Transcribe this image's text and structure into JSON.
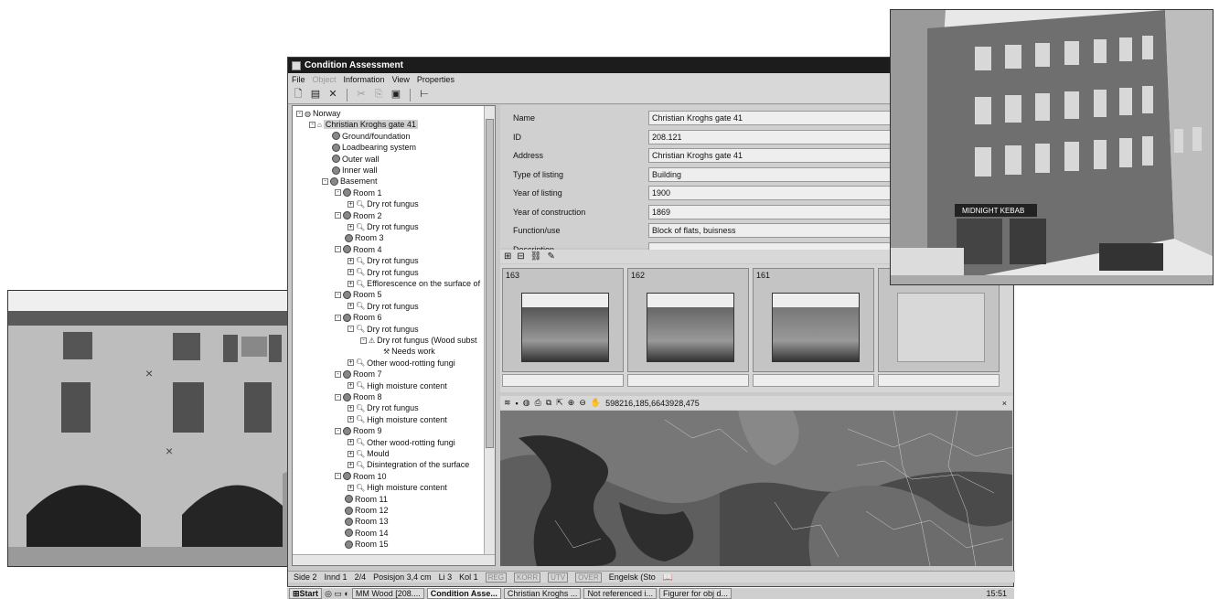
{
  "window": {
    "title": "Condition Assessment"
  },
  "menu": [
    "File",
    "Object",
    "Information",
    "View",
    "Properties"
  ],
  "menu_disabled": [
    "Object"
  ],
  "tree": [
    {
      "level": 0,
      "toggle": "−",
      "icon": "globe-icon",
      "label": "Norway"
    },
    {
      "level": 1,
      "toggle": "−",
      "icon": "building-icon",
      "label": "Christian Kroghs gate 41",
      "selected": true
    },
    {
      "level": 2,
      "toggle": "",
      "icon": "component-icon",
      "label": "Ground/foundation"
    },
    {
      "level": 2,
      "toggle": "",
      "icon": "component-icon",
      "label": "Loadbearing system"
    },
    {
      "level": 2,
      "toggle": "",
      "icon": "component-icon",
      "label": "Outer wall"
    },
    {
      "level": 2,
      "toggle": "",
      "icon": "component-icon",
      "label": "Inner wall"
    },
    {
      "level": 2,
      "toggle": "−",
      "icon": "component-icon",
      "label": "Basement"
    },
    {
      "level": 3,
      "toggle": "−",
      "icon": "component-icon",
      "label": "Room 1"
    },
    {
      "level": 4,
      "toggle": "+",
      "icon": "magnifier-icon",
      "label": "Dry rot fungus"
    },
    {
      "level": 3,
      "toggle": "−",
      "icon": "component-icon",
      "label": "Room 2"
    },
    {
      "level": 4,
      "toggle": "+",
      "icon": "magnifier-icon",
      "label": "Dry rot fungus"
    },
    {
      "level": 3,
      "toggle": "",
      "icon": "component-icon",
      "label": "Room 3"
    },
    {
      "level": 3,
      "toggle": "−",
      "icon": "component-icon",
      "label": "Room 4"
    },
    {
      "level": 4,
      "toggle": "+",
      "icon": "magnifier-icon",
      "label": "Dry rot fungus"
    },
    {
      "level": 4,
      "toggle": "+",
      "icon": "magnifier-icon",
      "label": "Dry rot fungus"
    },
    {
      "level": 4,
      "toggle": "+",
      "icon": "magnifier-icon",
      "label": "Efflorescence on the surface of"
    },
    {
      "level": 3,
      "toggle": "−",
      "icon": "component-icon",
      "label": "Room 5"
    },
    {
      "level": 4,
      "toggle": "+",
      "icon": "magnifier-icon",
      "label": "Dry rot fungus"
    },
    {
      "level": 3,
      "toggle": "−",
      "icon": "component-icon",
      "label": "Room 6"
    },
    {
      "level": 4,
      "toggle": "−",
      "icon": "magnifier-icon",
      "label": "Dry rot fungus"
    },
    {
      "level": 5,
      "toggle": "−",
      "icon": "warning-icon",
      "label": "Dry rot fungus (Wood subst"
    },
    {
      "level": 6,
      "toggle": "",
      "icon": "tool-icon",
      "label": "Needs work"
    },
    {
      "level": 4,
      "toggle": "+",
      "icon": "magnifier-icon",
      "label": "Other wood-rotting fungi"
    },
    {
      "level": 3,
      "toggle": "−",
      "icon": "component-icon",
      "label": "Room 7"
    },
    {
      "level": 4,
      "toggle": "+",
      "icon": "magnifier-icon",
      "label": "High moisture content"
    },
    {
      "level": 3,
      "toggle": "−",
      "icon": "component-icon",
      "label": "Room 8"
    },
    {
      "level": 4,
      "toggle": "+",
      "icon": "magnifier-icon",
      "label": "Dry rot fungus"
    },
    {
      "level": 4,
      "toggle": "+",
      "icon": "magnifier-icon",
      "label": "High moisture content"
    },
    {
      "level": 3,
      "toggle": "−",
      "icon": "component-icon",
      "label": "Room 9"
    },
    {
      "level": 4,
      "toggle": "+",
      "icon": "magnifier-icon",
      "label": "Other wood-rotting fungi"
    },
    {
      "level": 4,
      "toggle": "+",
      "icon": "magnifier-icon",
      "label": "Mould"
    },
    {
      "level": 4,
      "toggle": "+",
      "icon": "magnifier-icon",
      "label": "Disintegration of the surface"
    },
    {
      "level": 3,
      "toggle": "−",
      "icon": "component-icon",
      "label": "Room 10"
    },
    {
      "level": 4,
      "toggle": "+",
      "icon": "magnifier-icon",
      "label": "High moisture content"
    },
    {
      "level": 3,
      "toggle": "",
      "icon": "component-icon",
      "label": "Room 11"
    },
    {
      "level": 3,
      "toggle": "",
      "icon": "component-icon",
      "label": "Room 12"
    },
    {
      "level": 3,
      "toggle": "",
      "icon": "component-icon",
      "label": "Room 13"
    },
    {
      "level": 3,
      "toggle": "",
      "icon": "component-icon",
      "label": "Room 14"
    },
    {
      "level": 3,
      "toggle": "",
      "icon": "component-icon",
      "label": "Room 15"
    }
  ],
  "properties": [
    {
      "label": "Name",
      "value": "Christian Kroghs gate 41"
    },
    {
      "label": "ID",
      "value": "208.121"
    },
    {
      "label": "Address",
      "value": "Christian Kroghs gate 41"
    },
    {
      "label": "Type of listing",
      "value": "Building"
    },
    {
      "label": "Year of listing",
      "value": "1900"
    },
    {
      "label": "Year of construction",
      "value": "1869"
    },
    {
      "label": "Function/use",
      "value": "Block of flats, buisness"
    },
    {
      "label": "Description",
      "value": ""
    }
  ],
  "thumbnails": [
    {
      "num": "163"
    },
    {
      "num": "162"
    },
    {
      "num": "161"
    },
    {
      "num": ""
    }
  ],
  "map": {
    "coordinates": "598216,185,6643928,475",
    "close": "×"
  },
  "status": {
    "side": "Side 2",
    "innd": "Innd 1",
    "page": "2/4",
    "posisjon": "Posisjon 3,4 cm",
    "li": "Li 3",
    "kol": "Kol 1",
    "flags": [
      "REG",
      "KORR",
      "UTV",
      "OVER"
    ],
    "language": "Engelsk (Sto"
  },
  "taskbar": {
    "start": "Start",
    "items": [
      {
        "label": "MM Wood [208....",
        "active": false
      },
      {
        "label": "Condition Asse...",
        "active": true
      },
      {
        "label": "Christian Kroghs ...",
        "active": false
      },
      {
        "label": "Not referenced i...",
        "active": false
      },
      {
        "label": "Figurer for obj d...",
        "active": false
      }
    ],
    "clock": "15:51"
  },
  "photo_right": {
    "sign": "MIDNIGHT KEBAB"
  }
}
